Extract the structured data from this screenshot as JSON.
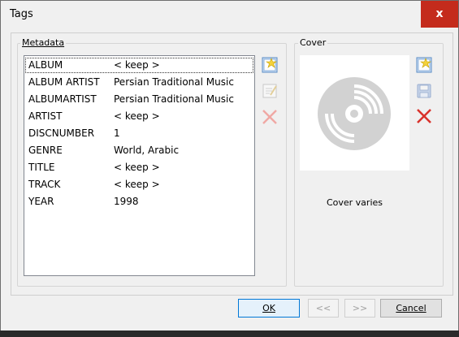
{
  "window": {
    "title": "Tags",
    "close_glyph": "x"
  },
  "metadata": {
    "label": "Metadata",
    "rows": [
      {
        "key": "ALBUM",
        "value": "< keep >"
      },
      {
        "key": "ALBUM ARTIST",
        "value": "Persian Traditional Music"
      },
      {
        "key": "ALBUMARTIST",
        "value": "Persian Traditional Music"
      },
      {
        "key": "ARTIST",
        "value": "< keep >"
      },
      {
        "key": "DISCNUMBER",
        "value": "1"
      },
      {
        "key": "GENRE",
        "value": "World, Arabic"
      },
      {
        "key": "TITLE",
        "value": "< keep >"
      },
      {
        "key": "TRACK",
        "value": "< keep >"
      },
      {
        "key": "YEAR",
        "value": "1998"
      }
    ],
    "icons": [
      "new-tag-icon",
      "edit-tag-icon",
      "delete-tag-icon"
    ]
  },
  "cover": {
    "label": "Cover",
    "caption": "Cover varies",
    "icons": [
      "load-cover-icon",
      "save-cover-icon",
      "remove-cover-icon"
    ]
  },
  "buttons": {
    "ok": "OK",
    "prev": "<<",
    "next": ">>",
    "cancel": "Cancel"
  },
  "colors": {
    "close_red": "#c42b1c",
    "delete_red": "#d9322b",
    "focus_blue": "#0078d7"
  }
}
